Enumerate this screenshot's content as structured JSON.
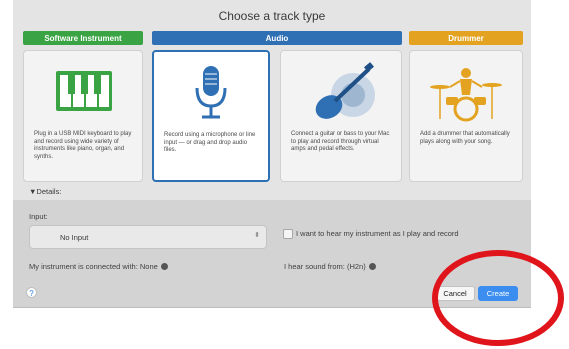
{
  "dialog": {
    "title": "Choose a track type",
    "categories": [
      {
        "label": "Software Instrument",
        "color": "#3aa444"
      },
      {
        "label": "Audio",
        "color": "#2f6fb3"
      },
      {
        "label": "Drummer",
        "color": "#e3a321"
      }
    ],
    "cards": [
      {
        "icon": "piano-keys-icon",
        "description": "Plug in a USB MIDI keyboard to play and record using wide variety of instruments like piano, organ, and synths.",
        "selected": false
      },
      {
        "icon": "microphone-icon",
        "description": "Record using a microphone or line input — or drag and drop audio files.",
        "selected": true
      },
      {
        "icon": "guitar-icon",
        "description": "Connect a guitar or bass to your Mac to play and record through virtual amps and pedal effects.",
        "selected": false
      },
      {
        "icon": "drum-kit-icon",
        "description": "Add a drummer that automatically plays along with your song.",
        "selected": false
      }
    ],
    "details_toggle": "▼Details:",
    "input_label": "Input:",
    "input_value": "No Input",
    "monitor_checkbox_label": "I want to hear my instrument as I play and record",
    "monitor_checked": false,
    "connected_text": "My instrument is connected with: None",
    "hear_from_text": "I hear sound from: (H2n)",
    "help_label": "?",
    "cancel_label": "Cancel",
    "create_label": "Create",
    "annotation_color": "#e0141b"
  }
}
